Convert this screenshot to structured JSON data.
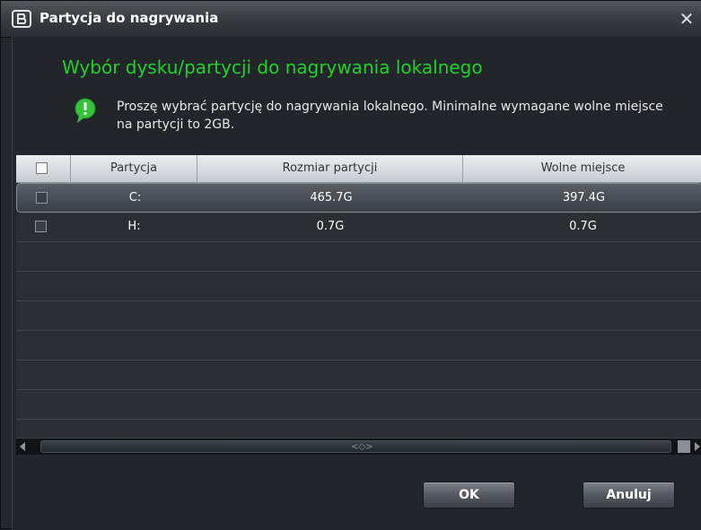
{
  "window": {
    "title": "Partycja do nagrywania",
    "close_glyph": "✕"
  },
  "heading": "Wybór dysku/partycji do nagrywania lokalnego",
  "info": {
    "icon": "info-bubble-icon",
    "text": "Proszę wybrać partycję do nagrywania lokalnego. Minimalne wymagane wolne miejsce na partycji to 2GB."
  },
  "table": {
    "columns": [
      "Partycja",
      "Rozmiar partycji",
      "Wolne miejsce"
    ],
    "rows": [
      {
        "partition": "C:",
        "size": "465.7G",
        "free": "397.4G",
        "selected": true
      },
      {
        "partition": "H:",
        "size": "0.7G",
        "free": "0.7G",
        "selected": false
      }
    ]
  },
  "buttons": {
    "ok": "OK",
    "cancel": "Anuluj"
  },
  "colors": {
    "accent_green": "#1fd22a",
    "window_bg": "#24282c"
  }
}
